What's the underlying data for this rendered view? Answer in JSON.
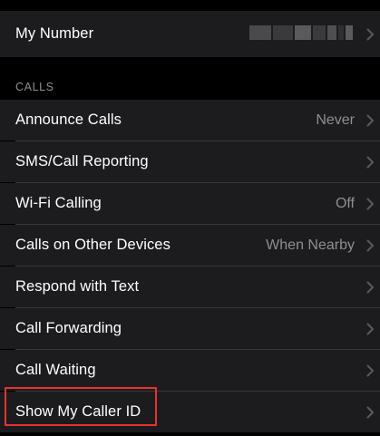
{
  "my_number": {
    "label": "My Number",
    "value_redacted": true
  },
  "calls_section": {
    "header": "CALLS",
    "items": [
      {
        "label": "Announce Calls",
        "value": "Never"
      },
      {
        "label": "SMS/Call Reporting",
        "value": ""
      },
      {
        "label": "Wi-Fi Calling",
        "value": "Off"
      },
      {
        "label": "Calls on Other Devices",
        "value": "When Nearby"
      },
      {
        "label": "Respond with Text",
        "value": ""
      },
      {
        "label": "Call Forwarding",
        "value": ""
      },
      {
        "label": "Call Waiting",
        "value": ""
      },
      {
        "label": "Show My Caller ID",
        "value": ""
      }
    ]
  },
  "icons": {
    "disclosure": "chevron-right-icon"
  },
  "colors": {
    "background": "#000000",
    "cell_background": "#1c1c1e",
    "primary_text": "#ffffff",
    "secondary_text": "#8e8e93",
    "highlight_border": "#e8322f"
  }
}
